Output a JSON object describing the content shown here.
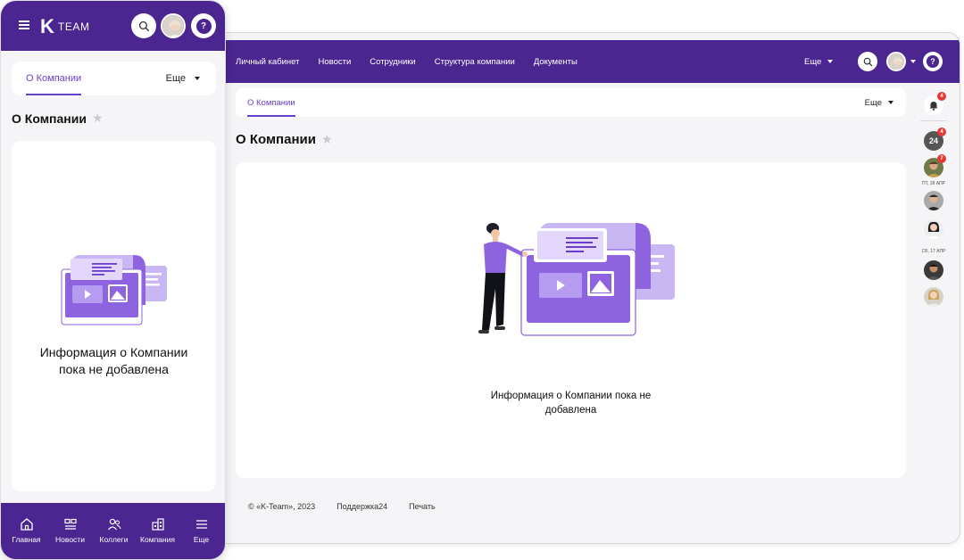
{
  "desktop": {
    "nav": [
      "Личный кабинет",
      "Новости",
      "Сотрудники",
      "Структура компании",
      "Документы"
    ],
    "more_label": "Еще",
    "tab_active": "О Компании",
    "tab_more": "Еще",
    "page_title": "О Компании",
    "empty_message": "Информация о Компании пока не добавлена",
    "footer": {
      "copyright": "© «K-Team», 2023",
      "support": "Поддержка24",
      "print": "Печать"
    },
    "rail": {
      "bell_badge": "4",
      "b24_label": "24",
      "b24_badge": "4",
      "avatar_badge": "7",
      "date_1": "ПТ, 28 АПР",
      "date_2": "СБ, 17 АПР"
    }
  },
  "mobile": {
    "logo_text": "TEAM",
    "tab_active": "О Компании",
    "tab_more": "Еще",
    "page_title": "О Компании",
    "empty_message_line1": "Информация о Компании",
    "empty_message_line2": "пока не добавлена",
    "bottom_nav": [
      "Главная",
      "Новости",
      "Коллеги",
      "Компания",
      "Еще"
    ]
  },
  "colors": {
    "brand": "#4b2590",
    "accent": "#6b3ec9",
    "illustration_light": "#c9b7f3",
    "illustration_mid": "#8e63e0",
    "badge": "#e53935"
  },
  "icons": [
    "menu-icon",
    "search-icon",
    "help-icon",
    "bell-icon",
    "star-icon",
    "home-icon",
    "news-icon",
    "people-icon",
    "buildings-icon",
    "more-lines-icon"
  ]
}
